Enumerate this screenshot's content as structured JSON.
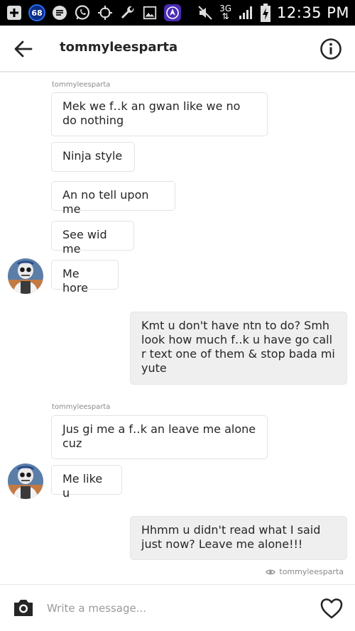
{
  "status_bar": {
    "notification_count": "68",
    "network": "3G",
    "time": "12:35 PM",
    "icons": [
      "plus-box-icon",
      "notification-badge-icon",
      "message-icon",
      "whatsapp-icon",
      "gps-icon",
      "wrench-icon",
      "image-icon",
      "nav-a-icon",
      "mute-icon",
      "signal-icon",
      "battery-charging-icon"
    ]
  },
  "header": {
    "title": "tommyleesparta",
    "back_icon": "arrow-left-icon",
    "info_icon": "info-circle-icon"
  },
  "messages": {
    "group1_sender": "tommyleesparta",
    "m1": "Mek we f․․k an gwan like we no do nothing",
    "m2": "Ninja style",
    "m3": "An no tell upon me",
    "m4": "See wid me",
    "m5": "Me hore",
    "m6": "Kmt u don't have ntn to do? Smh look how much f․․k u have go call r text one of them & stop bada mi yute",
    "group2_sender": "tommyleesparta",
    "m7": "Jus gi me a f․․k an leave me alone cuz",
    "m8": "Me like u",
    "m9": "Hhmm u didn't read what I said just now? Leave me alone!!!",
    "seen_by": "tommyleesparta"
  },
  "composer": {
    "placeholder": "Write a message...",
    "camera_icon": "camera-icon",
    "like_icon": "heart-icon"
  }
}
